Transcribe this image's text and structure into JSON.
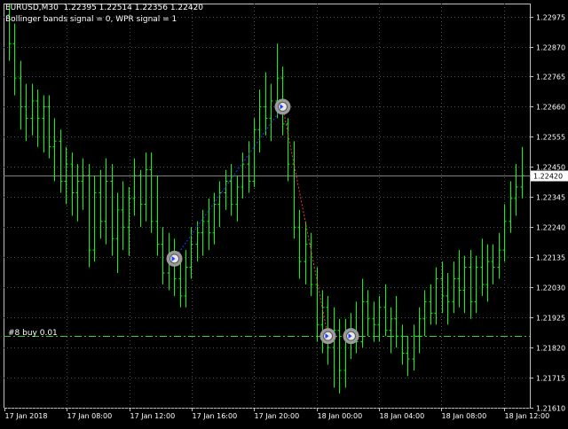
{
  "header": {
    "symbol": "EURUSD,M30",
    "ohlc": "1.22395 1.22514 1.22356 1.22420",
    "signal_text": "Bollinger bands signal = 0, WPR signal = 1"
  },
  "trade_label": "#8 buy 0.01",
  "price_axis": {
    "min": 1.2161,
    "max": 1.2302,
    "ticks": [
      "1.22975",
      "1.22870",
      "1.22765",
      "1.22660",
      "1.22555",
      "1.22450",
      "1.22345",
      "1.22240",
      "1.22135",
      "1.22030",
      "1.21925",
      "1.21820",
      "1.21715",
      "1.21610"
    ],
    "current": "1.22420"
  },
  "time_axis": [
    "17 Jan 2018",
    "17 Jan 08:00",
    "17 Jan 12:00",
    "17 Jan 16:00",
    "17 Jan 20:00",
    "18 Jan 00:00",
    "18 Jan 04:00",
    "18 Jan 08:00",
    "18 Jan 12:00"
  ],
  "chart_data": {
    "type": "ohlc",
    "instrument": "EURUSD",
    "timeframe": "M30",
    "trade_level": 1.2186,
    "trade_markers": [
      {
        "bar": 29,
        "price": 1.2213
      },
      {
        "bar": 48,
        "price": 1.2266
      },
      {
        "bar": 56,
        "price": 1.2186
      },
      {
        "bar": 60,
        "price": 1.2186
      }
    ],
    "trend_lines": [
      {
        "from_bar": 29,
        "from_price": 1.2213,
        "to_bar": 48,
        "to_price": 1.2266,
        "color": "#1e3aff"
      },
      {
        "from_bar": 48,
        "from_price": 1.2266,
        "to_bar": 56,
        "to_price": 1.2186,
        "color": "#ff3030"
      }
    ],
    "bars": [
      [
        1.2298,
        1.2302,
        1.2282,
        1.2288
      ],
      [
        1.2288,
        1.2295,
        1.227,
        1.2276
      ],
      [
        1.2276,
        1.2282,
        1.2258,
        1.2266
      ],
      [
        1.2266,
        1.2274,
        1.2254,
        1.2262
      ],
      [
        1.2262,
        1.2274,
        1.2256,
        1.2268
      ],
      [
        1.2268,
        1.2272,
        1.2252,
        1.2262
      ],
      [
        1.2262,
        1.227,
        1.225,
        1.2266
      ],
      [
        1.2266,
        1.227,
        1.2248,
        1.2252
      ],
      [
        1.2252,
        1.2262,
        1.224,
        1.2254
      ],
      [
        1.2254,
        1.2258,
        1.2236,
        1.224
      ],
      [
        1.224,
        1.2252,
        1.2232,
        1.2246
      ],
      [
        1.2246,
        1.225,
        1.2228,
        1.2236
      ],
      [
        1.2236,
        1.2246,
        1.2226,
        1.224
      ],
      [
        1.224,
        1.2248,
        1.223,
        1.2242
      ],
      [
        1.2242,
        1.2246,
        1.221,
        1.2216
      ],
      [
        1.2216,
        1.2242,
        1.2212,
        1.2236
      ],
      [
        1.2236,
        1.2244,
        1.222,
        1.2226
      ],
      [
        1.2226,
        1.2248,
        1.2218,
        1.224
      ],
      [
        1.224,
        1.2246,
        1.2214,
        1.222
      ],
      [
        1.222,
        1.2236,
        1.2208,
        1.223
      ],
      [
        1.223,
        1.224,
        1.2216,
        1.2224
      ],
      [
        1.2224,
        1.2238,
        1.2214,
        1.2234
      ],
      [
        1.2234,
        1.2248,
        1.2228,
        1.2242
      ],
      [
        1.2242,
        1.2244,
        1.2224,
        1.2232
      ],
      [
        1.2232,
        1.225,
        1.2226,
        1.2244
      ],
      [
        1.2244,
        1.225,
        1.2222,
        1.2226
      ],
      [
        1.2226,
        1.2242,
        1.2214,
        1.2218
      ],
      [
        1.2218,
        1.2224,
        1.2204,
        1.2208
      ],
      [
        1.2208,
        1.2222,
        1.2202,
        1.2214
      ],
      [
        1.2214,
        1.222,
        1.22,
        1.2206
      ],
      [
        1.2206,
        1.2212,
        1.2196,
        1.22
      ],
      [
        1.22,
        1.2216,
        1.2196,
        1.221
      ],
      [
        1.221,
        1.2224,
        1.2206,
        1.2218
      ],
      [
        1.2218,
        1.2226,
        1.2212,
        1.2222
      ],
      [
        1.2222,
        1.223,
        1.2214,
        1.2226
      ],
      [
        1.2226,
        1.2234,
        1.2216,
        1.2222
      ],
      [
        1.2222,
        1.2236,
        1.2218,
        1.2232
      ],
      [
        1.2232,
        1.224,
        1.2224,
        1.2236
      ],
      [
        1.2236,
        1.2244,
        1.223,
        1.224
      ],
      [
        1.224,
        1.2246,
        1.2228,
        1.2232
      ],
      [
        1.2232,
        1.2242,
        1.2226,
        1.2238
      ],
      [
        1.2238,
        1.225,
        1.2234,
        1.2246
      ],
      [
        1.2246,
        1.2254,
        1.2236,
        1.224
      ],
      [
        1.224,
        1.2262,
        1.2238,
        1.2258
      ],
      [
        1.2258,
        1.2272,
        1.225,
        1.2266
      ],
      [
        1.2266,
        1.2278,
        1.2256,
        1.2262
      ],
      [
        1.2262,
        1.2274,
        1.2254,
        1.2268
      ],
      [
        1.2268,
        1.2288,
        1.2262,
        1.2276
      ],
      [
        1.2276,
        1.228,
        1.2256,
        1.226
      ],
      [
        1.226,
        1.2262,
        1.224,
        1.2246
      ],
      [
        1.2246,
        1.2254,
        1.222,
        1.2224
      ],
      [
        1.2224,
        1.223,
        1.2206,
        1.2212
      ],
      [
        1.2212,
        1.2226,
        1.2204,
        1.2218
      ],
      [
        1.2218,
        1.2222,
        1.22,
        1.2204
      ],
      [
        1.2204,
        1.221,
        1.2184,
        1.219
      ],
      [
        1.219,
        1.2202,
        1.218,
        1.2196
      ],
      [
        1.2196,
        1.22,
        1.2176,
        1.2182
      ],
      [
        1.2182,
        1.2196,
        1.2168,
        1.2188
      ],
      [
        1.2188,
        1.2192,
        1.2166,
        1.2174
      ],
      [
        1.2174,
        1.2192,
        1.2168,
        1.2186
      ],
      [
        1.2186,
        1.2194,
        1.2178,
        1.2188
      ],
      [
        1.2188,
        1.2198,
        1.218,
        1.2184
      ],
      [
        1.2184,
        1.2206,
        1.2182,
        1.2198
      ],
      [
        1.2198,
        1.2202,
        1.2186,
        1.2192
      ],
      [
        1.2192,
        1.2198,
        1.2184,
        1.219
      ],
      [
        1.219,
        1.22,
        1.2184,
        1.2196
      ],
      [
        1.2196,
        1.2204,
        1.2186,
        1.2188
      ],
      [
        1.2188,
        1.2196,
        1.218,
        1.2192
      ],
      [
        1.2192,
        1.22,
        1.2182,
        1.2186
      ],
      [
        1.2186,
        1.219,
        1.2176,
        1.218
      ],
      [
        1.218,
        1.2186,
        1.2172,
        1.2178
      ],
      [
        1.2178,
        1.219,
        1.2174,
        1.2186
      ],
      [
        1.2186,
        1.2196,
        1.218,
        1.2192
      ],
      [
        1.2192,
        1.2202,
        1.2186,
        1.2198
      ],
      [
        1.2198,
        1.2204,
        1.219,
        1.2194
      ],
      [
        1.2194,
        1.221,
        1.219,
        1.2206
      ],
      [
        1.2206,
        1.2212,
        1.2194,
        1.22
      ],
      [
        1.22,
        1.2208,
        1.219,
        1.2198
      ],
      [
        1.2198,
        1.2212,
        1.2194,
        1.2206
      ],
      [
        1.2206,
        1.2216,
        1.2196,
        1.2202
      ],
      [
        1.2202,
        1.2214,
        1.2194,
        1.221
      ],
      [
        1.221,
        1.2216,
        1.2192,
        1.2198
      ],
      [
        1.2198,
        1.2214,
        1.2194,
        1.221
      ],
      [
        1.221,
        1.222,
        1.22,
        1.2204
      ],
      [
        1.2204,
        1.2218,
        1.2198,
        1.2212
      ],
      [
        1.2212,
        1.2218,
        1.2204,
        1.221
      ],
      [
        1.221,
        1.2222,
        1.2206,
        1.2216
      ],
      [
        1.2216,
        1.2232,
        1.2212,
        1.2226
      ],
      [
        1.2226,
        1.224,
        1.2222,
        1.2234
      ],
      [
        1.2234,
        1.2246,
        1.2228,
        1.2238
      ],
      [
        1.2238,
        1.2252,
        1.2234,
        1.2242
      ]
    ]
  }
}
